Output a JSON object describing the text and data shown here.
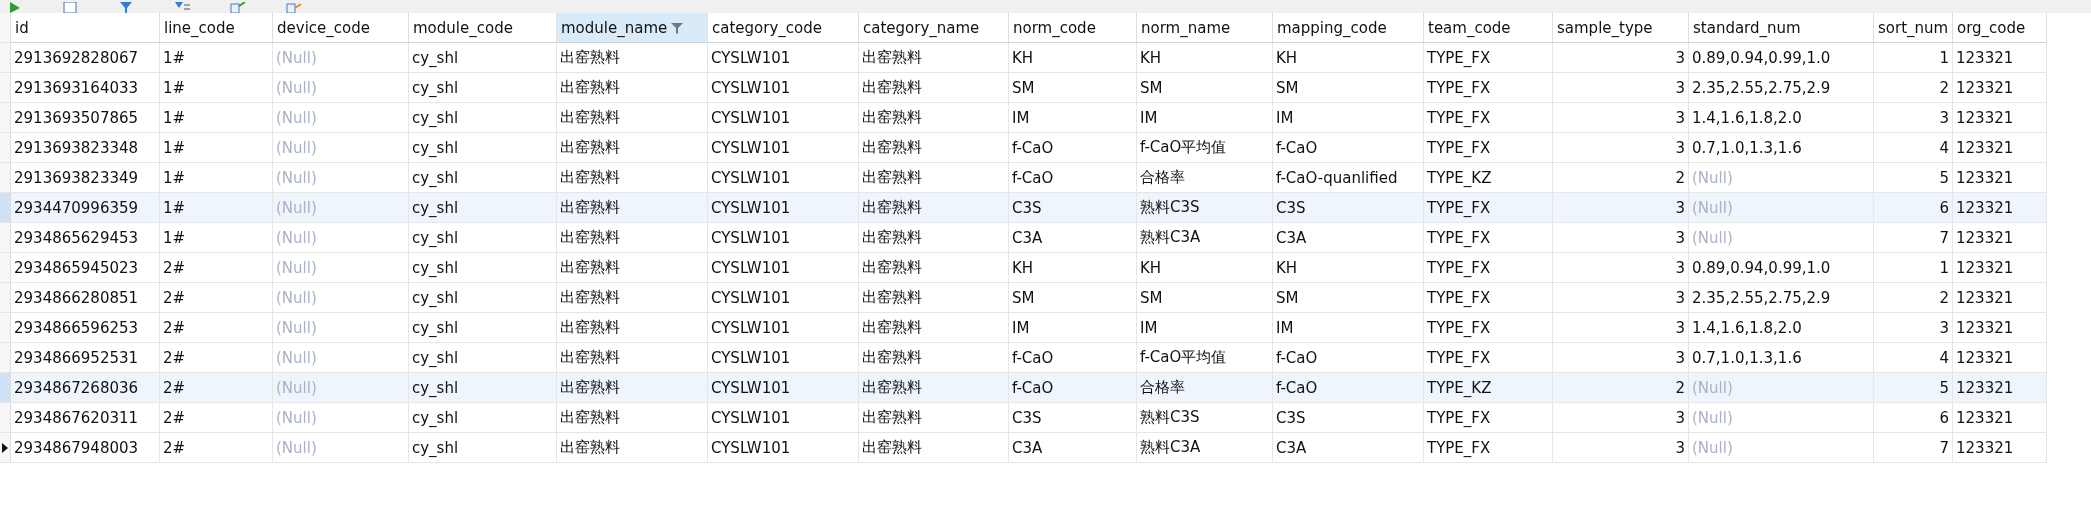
{
  "table": {
    "columns": [
      {
        "label": "id",
        "filtered": false
      },
      {
        "label": "line_code",
        "filtered": false
      },
      {
        "label": "device_code",
        "filtered": false
      },
      {
        "label": "module_code",
        "filtered": false
      },
      {
        "label": "module_name",
        "filtered": true
      },
      {
        "label": "category_code",
        "filtered": false
      },
      {
        "label": "category_name",
        "filtered": false
      },
      {
        "label": "norm_code",
        "filtered": false
      },
      {
        "label": "norm_name",
        "filtered": false
      },
      {
        "label": "mapping_code",
        "filtered": false
      },
      {
        "label": "team_code",
        "filtered": false
      },
      {
        "label": "sample_type",
        "filtered": false
      },
      {
        "label": "standard_num",
        "filtered": false
      },
      {
        "label": "sort_num",
        "filtered": false
      },
      {
        "label": "org_code",
        "filtered": false
      }
    ],
    "rows": [
      {
        "current": false,
        "highlighted": false,
        "cells": [
          "2913692828067",
          "1#",
          {
            "text": "(Null)",
            "null": true
          },
          "cy_shl",
          "出窑熟料",
          "CYSLW101",
          "出窑熟料",
          "KH",
          "KH",
          "KH",
          "TYPE_FX",
          "3",
          "0.89,0.94,0.99,1.0",
          "1",
          "123321"
        ]
      },
      {
        "current": false,
        "highlighted": false,
        "cells": [
          "2913693164033",
          "1#",
          {
            "text": "(Null)",
            "null": true
          },
          "cy_shl",
          "出窑熟料",
          "CYSLW101",
          "出窑熟料",
          "SM",
          "SM",
          "SM",
          "TYPE_FX",
          "3",
          "2.35,2.55,2.75,2.9",
          "2",
          "123321"
        ]
      },
      {
        "current": false,
        "highlighted": false,
        "cells": [
          "2913693507865",
          "1#",
          {
            "text": "(Null)",
            "null": true
          },
          "cy_shl",
          "出窑熟料",
          "CYSLW101",
          "出窑熟料",
          "IM",
          "IM",
          "IM",
          "TYPE_FX",
          "3",
          "1.4,1.6,1.8,2.0",
          "3",
          "123321"
        ]
      },
      {
        "current": false,
        "highlighted": false,
        "cells": [
          "2913693823348",
          "1#",
          {
            "text": "(Null)",
            "null": true
          },
          "cy_shl",
          "出窑熟料",
          "CYSLW101",
          "出窑熟料",
          "f-CaO",
          "f-CaO平均值",
          "f-CaO",
          "TYPE_FX",
          "3",
          "0.7,1.0,1.3,1.6",
          "4",
          "123321"
        ]
      },
      {
        "current": false,
        "highlighted": false,
        "cells": [
          "2913693823349",
          "1#",
          {
            "text": "(Null)",
            "null": true
          },
          "cy_shl",
          "出窑熟料",
          "CYSLW101",
          "出窑熟料",
          "f-CaO",
          "合格率",
          "f-CaO-quanlified",
          "TYPE_KZ",
          "2",
          {
            "text": "(Null)",
            "null": true
          },
          "5",
          "123321"
        ]
      },
      {
        "current": false,
        "highlighted": true,
        "cells": [
          "2934470996359",
          "1#",
          {
            "text": "(Null)",
            "null": true
          },
          "cy_shl",
          "出窑熟料",
          "CYSLW101",
          "出窑熟料",
          "C3S",
          "熟料C3S",
          "C3S",
          "TYPE_FX",
          "3",
          {
            "text": "(Null)",
            "null": true
          },
          "6",
          "123321"
        ]
      },
      {
        "current": false,
        "highlighted": false,
        "cells": [
          "2934865629453",
          "1#",
          {
            "text": "(Null)",
            "null": true
          },
          "cy_shl",
          "出窑熟料",
          "CYSLW101",
          "出窑熟料",
          "C3A",
          "熟料C3A",
          "C3A",
          "TYPE_FX",
          "3",
          {
            "text": "(Null)",
            "null": true
          },
          "7",
          "123321"
        ]
      },
      {
        "current": false,
        "highlighted": false,
        "cells": [
          "2934865945023",
          "2#",
          {
            "text": "(Null)",
            "null": true
          },
          "cy_shl",
          "出窑熟料",
          "CYSLW101",
          "出窑熟料",
          "KH",
          "KH",
          "KH",
          "TYPE_FX",
          "3",
          "0.89,0.94,0.99,1.0",
          "1",
          "123321"
        ]
      },
      {
        "current": false,
        "highlighted": false,
        "cells": [
          "2934866280851",
          "2#",
          {
            "text": "(Null)",
            "null": true
          },
          "cy_shl",
          "出窑熟料",
          "CYSLW101",
          "出窑熟料",
          "SM",
          "SM",
          "SM",
          "TYPE_FX",
          "3",
          "2.35,2.55,2.75,2.9",
          "2",
          "123321"
        ]
      },
      {
        "current": false,
        "highlighted": false,
        "cells": [
          "2934866596253",
          "2#",
          {
            "text": "(Null)",
            "null": true
          },
          "cy_shl",
          "出窑熟料",
          "CYSLW101",
          "出窑熟料",
          "IM",
          "IM",
          "IM",
          "TYPE_FX",
          "3",
          "1.4,1.6,1.8,2.0",
          "3",
          "123321"
        ]
      },
      {
        "current": false,
        "highlighted": false,
        "cells": [
          "2934866952531",
          "2#",
          {
            "text": "(Null)",
            "null": true
          },
          "cy_shl",
          "出窑熟料",
          "CYSLW101",
          "出窑熟料",
          "f-CaO",
          "f-CaO平均值",
          "f-CaO",
          "TYPE_FX",
          "3",
          "0.7,1.0,1.3,1.6",
          "4",
          "123321"
        ]
      },
      {
        "current": false,
        "highlighted": true,
        "cells": [
          "2934867268036",
          "2#",
          {
            "text": "(Null)",
            "null": true
          },
          "cy_shl",
          "出窑熟料",
          "CYSLW101",
          "出窑熟料",
          "f-CaO",
          "合格率",
          "f-CaO",
          "TYPE_KZ",
          "2",
          {
            "text": "(Null)",
            "null": true
          },
          "5",
          "123321"
        ]
      },
      {
        "current": false,
        "highlighted": false,
        "cells": [
          "2934867620311",
          "2#",
          {
            "text": "(Null)",
            "null": true
          },
          "cy_shl",
          "出窑熟料",
          "CYSLW101",
          "出窑熟料",
          "C3S",
          "熟料C3S",
          "C3S",
          "TYPE_FX",
          "3",
          {
            "text": "(Null)",
            "null": true
          },
          "6",
          "123321"
        ]
      },
      {
        "current": true,
        "highlighted": false,
        "cells": [
          "2934867948003",
          "2#",
          {
            "text": "(Null)",
            "null": true
          },
          "cy_shl",
          "出窑熟料",
          "CYSLW101",
          "出窑熟料",
          "C3A",
          "熟料C3A",
          "C3A",
          "TYPE_FX",
          "3",
          {
            "text": "(Null)",
            "null": true
          },
          "7",
          "123321"
        ]
      }
    ]
  }
}
